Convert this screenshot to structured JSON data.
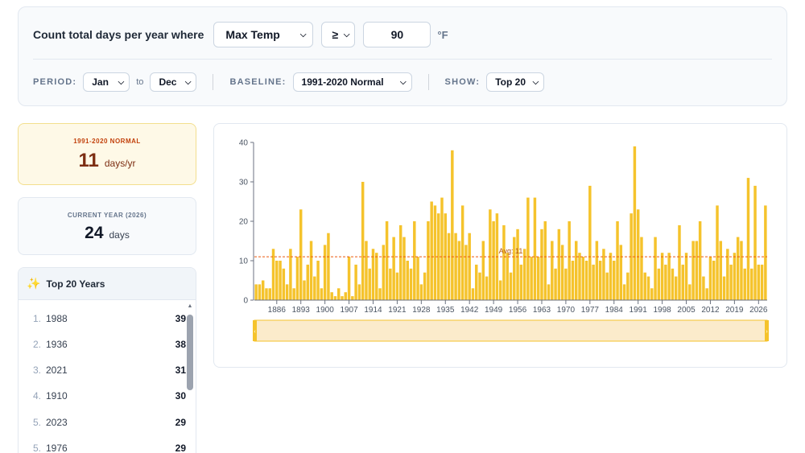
{
  "query": {
    "label": "Count total days per year where",
    "metric": "Max Temp",
    "operator": "≥",
    "threshold": "90",
    "unit": "°F",
    "period_label": "PERIOD:",
    "period_from": "Jan",
    "period_to_word": "to",
    "period_to": "Dec",
    "baseline_label": "BASELINE:",
    "baseline": "1991-2020 Normal",
    "show_label": "SHOW:",
    "show": "Top 20"
  },
  "normal_card": {
    "caption": "1991-2020 NORMAL",
    "value": "11",
    "unit": "days/yr"
  },
  "current_card": {
    "caption": "CURRENT YEAR (2026)",
    "value": "24",
    "unit": "days"
  },
  "top_years": {
    "title": "Top 20 Years",
    "rows": [
      {
        "rank": "1.",
        "year": "1988",
        "count": "39"
      },
      {
        "rank": "2.",
        "year": "1936",
        "count": "38"
      },
      {
        "rank": "3.",
        "year": "2021",
        "count": "31"
      },
      {
        "rank": "4.",
        "year": "1910",
        "count": "30"
      },
      {
        "rank": "5.",
        "year": "2023",
        "count": "29"
      },
      {
        "rank": "5.",
        "year": "1976",
        "count": "29"
      }
    ]
  },
  "colors": {
    "bar": "#f5c32c",
    "avg_line": "#ea580c",
    "accent": "#eab308"
  },
  "icons": {
    "top_years": "sparkle-icon"
  },
  "chart_data": {
    "type": "bar",
    "start_year": 1880,
    "end_year": 2026,
    "ylim": [
      0,
      40
    ],
    "yticks": [
      0,
      10,
      20,
      30,
      40
    ],
    "xticks": [
      1886,
      1893,
      1900,
      1907,
      1914,
      1921,
      1928,
      1935,
      1942,
      1949,
      1956,
      1963,
      1970,
      1977,
      1984,
      1991,
      1998,
      2005,
      2012,
      2019,
      2026
    ],
    "avg_label": "Avg: 11",
    "avg_value": 11,
    "values": [
      4,
      4,
      5,
      3,
      3,
      13,
      10,
      10,
      8,
      4,
      13,
      3,
      11,
      23,
      5,
      9,
      15,
      6,
      10,
      3,
      14,
      17,
      2,
      1,
      3,
      1,
      2,
      11,
      1,
      9,
      4,
      30,
      15,
      8,
      13,
      12,
      3,
      14,
      20,
      8,
      16,
      7,
      19,
      16,
      10,
      8,
      20,
      11,
      4,
      7,
      20,
      25,
      24,
      22,
      26,
      22,
      17,
      38,
      17,
      15,
      24,
      14,
      17,
      3,
      9,
      7,
      15,
      6,
      23,
      20,
      22,
      5,
      19,
      12,
      7,
      16,
      18,
      9,
      13,
      26,
      11,
      26,
      11,
      18,
      20,
      4,
      15,
      8,
      18,
      14,
      8,
      20,
      10,
      15,
      12,
      11,
      10,
      29,
      9,
      15,
      10,
      13,
      7,
      12,
      10,
      20,
      14,
      4,
      7,
      22,
      39,
      23,
      16,
      7,
      6,
      3,
      16,
      8,
      12,
      9,
      12,
      8,
      6,
      19,
      9,
      12,
      4,
      15,
      15,
      20,
      6,
      3,
      11,
      10,
      24,
      15,
      6,
      13,
      9,
      12,
      16,
      15,
      8,
      31,
      8,
      29,
      9,
      9,
      24
    ]
  }
}
